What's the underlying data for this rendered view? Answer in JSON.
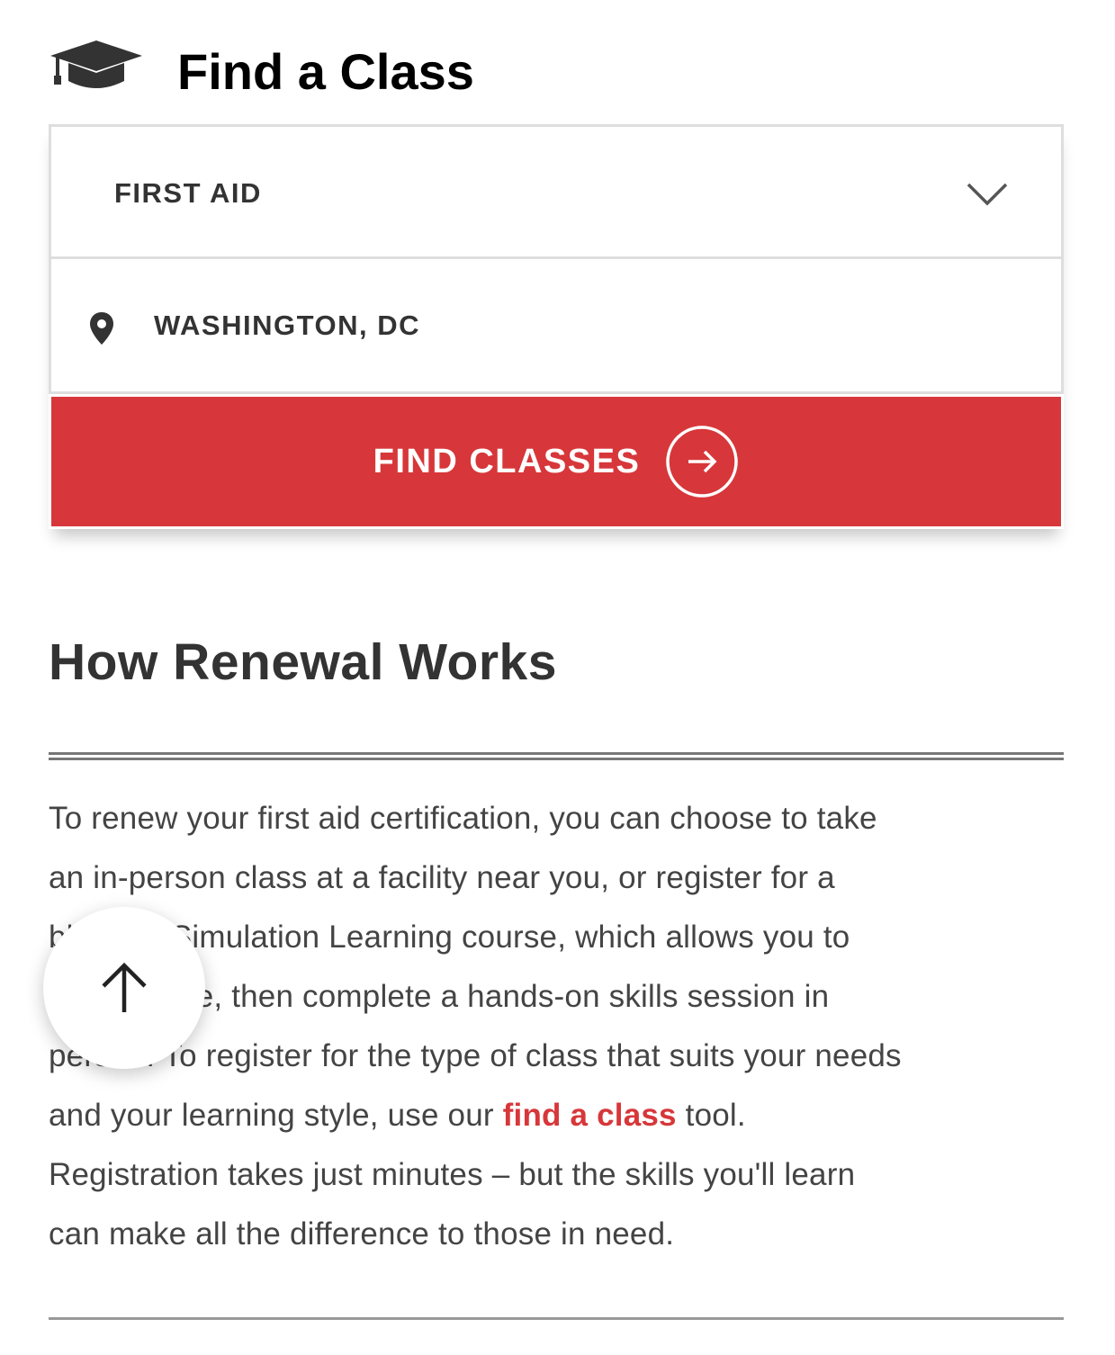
{
  "header": {
    "title": "Find a Class",
    "icon": "graduation-cap-icon"
  },
  "form": {
    "course_select": {
      "value": "FIRST AID",
      "icon": "chevron-down-icon"
    },
    "location": {
      "value": "WASHINGTON, DC",
      "icon": "map-pin-icon"
    },
    "submit": {
      "label": "FIND CLASSES",
      "icon": "arrow-right-circle-icon"
    }
  },
  "section": {
    "heading": "How Renewal Works",
    "paragraph": {
      "l1": "To renew your first aid certification, you can choose to take",
      "l2": "an in-person class at a facility near you, or register for a",
      "l3": "blended Simulation Learning course, which allows you to",
      "l4": "learn online, then complete a hands-on skills session in",
      "l5": "person. To register for the type of class that suits your needs",
      "l6_before": "and your learning style, use our ",
      "link": "find a class",
      "l6_after": " tool.",
      "l7": "Registration takes just minutes – but the skills you'll learn",
      "l8": "can make all the difference to those in need."
    }
  },
  "back_to_top": {
    "icon": "arrow-up-icon"
  },
  "colors": {
    "brand_red": "#d7373a",
    "text": "#333333"
  }
}
